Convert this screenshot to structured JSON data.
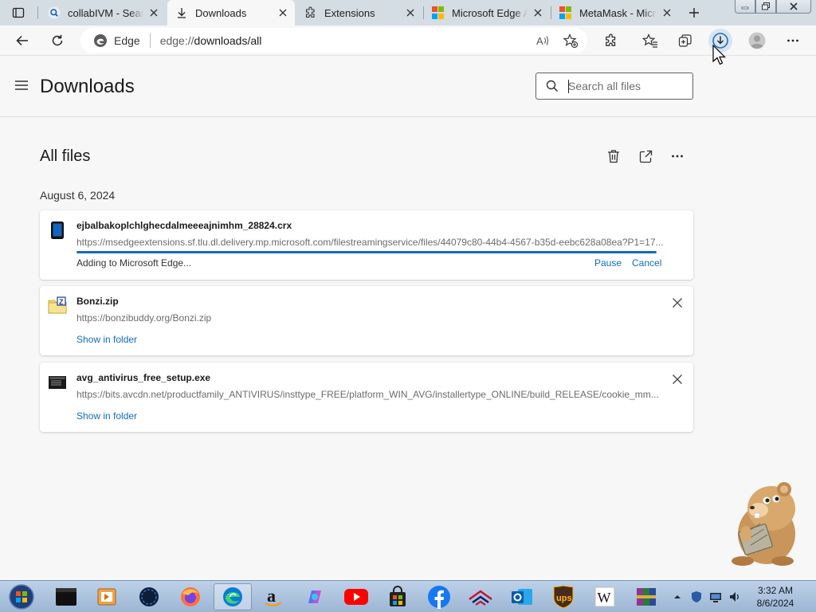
{
  "browser": {
    "tabs": [
      {
        "title": "collabIVM - Search",
        "icon": "search-icon",
        "active": false
      },
      {
        "title": "Downloads",
        "icon": "download-icon",
        "active": true
      },
      {
        "title": "Extensions",
        "icon": "puzzle-icon",
        "active": false
      },
      {
        "title": "Microsoft Edge Add-ons",
        "icon": "microsoft-logo-icon",
        "active": false
      },
      {
        "title": "MetaMask - Microsoft Edge Add-ons",
        "icon": "microsoft-logo-icon",
        "active": false
      }
    ],
    "address": {
      "badge": "Edge",
      "url_scheme": "edge://",
      "url_path": "downloads/all"
    }
  },
  "page": {
    "title": "Downloads",
    "search_placeholder": "Search all files",
    "section_title": "All files",
    "date_group": "August 6, 2024"
  },
  "downloads": [
    {
      "name": "ejbalbakoplchlghecdalmeeeajnimhm_28824.crx",
      "url": "https://msedgeextensions.sf.tlu.dl.delivery.mp.microsoft.com/filestreamingservice/files/44079c80-44b4-4567-b35d-eebc628a08ea?P1=17...",
      "status": "Adding to Microsoft Edge...",
      "progress": 1.0,
      "pause_label": "Pause",
      "cancel_label": "Cancel",
      "icon": "crx-file-icon"
    },
    {
      "name": "Bonzi.zip",
      "url": "https://bonzibuddy.org/Bonzi.zip",
      "action_label": "Show in folder",
      "icon": "zip-file-icon"
    },
    {
      "name": "avg_antivirus_free_setup.exe",
      "url": "https://bits.avcdn.net/productfamily_ANTIVIRUS/insttype_FREE/platform_WIN_AVG/installertype_ONLINE/build_RELEASE/cookie_mm...",
      "action_label": "Show in folder",
      "icon": "exe-file-icon"
    }
  ],
  "taskbar": {
    "apps": [
      "start-orb-icon",
      "terminal-icon",
      "media-player-icon",
      "globe-icon",
      "firefox-icon",
      "edge-icon",
      "amazon-icon",
      "copilot-icon",
      "youtube-icon",
      "store-bag-icon",
      "facebook-icon",
      "bank-of-america-icon",
      "outlook-icon",
      "ups-icon",
      "wikipedia-icon",
      "winrar-icon"
    ],
    "time": "3:32 AM",
    "date": "8/6/2024"
  },
  "colors": {
    "accent": "#0f6cbd",
    "tabstrip": "#d4dce4",
    "page_bg": "#f7f7f7"
  }
}
